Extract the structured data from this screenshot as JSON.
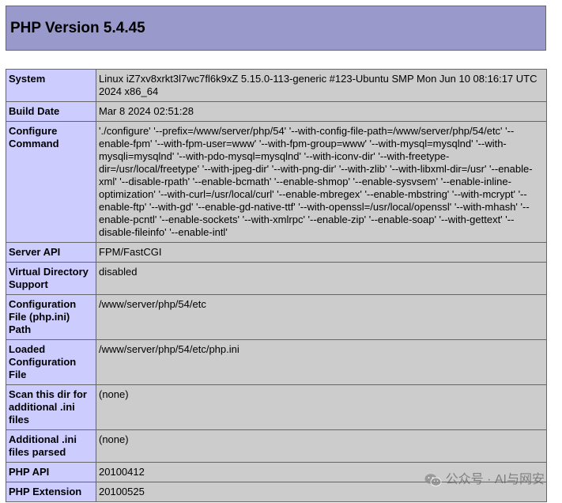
{
  "header": {
    "title": "PHP Version 5.4.45"
  },
  "rows": [
    {
      "key": "System",
      "value": "Linux iZ7xv8xrkt3l7wc7fl6k9xZ 5.15.0-113-generic #123-Ubuntu SMP Mon Jun 10 08:16:17 UTC 2024 x86_64"
    },
    {
      "key": "Build Date",
      "value": "Mar 8 2024 02:51:28"
    },
    {
      "key": "Configure Command",
      "value": "'./configure' '--prefix=/www/server/php/54' '--with-config-file-path=/www/server/php/54/etc' '--enable-fpm' '--with-fpm-user=www' '--with-fpm-group=www' '--with-mysql=mysqlnd' '--with-mysqli=mysqlnd' '--with-pdo-mysql=mysqlnd' '--with-iconv-dir' '--with-freetype-dir=/usr/local/freetype' '--with-jpeg-dir' '--with-png-dir' '--with-zlib' '--with-libxml-dir=/usr' '--enable-xml' '--disable-rpath' '--enable-bcmath' '--enable-shmop' '--enable-sysvsem' '--enable-inline-optimization' '--with-curl=/usr/local/curl' '--enable-mbregex' '--enable-mbstring' '--with-mcrypt' '--enable-ftp' '--with-gd' '--enable-gd-native-ttf' '--with-openssl=/usr/local/openssl' '--with-mhash' '--enable-pcntl' '--enable-sockets' '--with-xmlrpc' '--enable-zip' '--enable-soap' '--with-gettext' '--disable-fileinfo' '--enable-intl'"
    },
    {
      "key": "Server API",
      "value": "FPM/FastCGI"
    },
    {
      "key": "Virtual Directory Support",
      "value": "disabled"
    },
    {
      "key": "Configuration File (php.ini) Path",
      "value": "/www/server/php/54/etc"
    },
    {
      "key": "Loaded Configuration File",
      "value": "/www/server/php/54/etc/php.ini"
    },
    {
      "key": "Scan this dir for additional .ini files",
      "value": "(none)"
    },
    {
      "key": "Additional .ini files parsed",
      "value": "(none)"
    },
    {
      "key": "PHP API",
      "value": "20100412"
    },
    {
      "key": "PHP Extension",
      "value": "20100525"
    }
  ],
  "watermark": {
    "text": "公众号 · AI与网安",
    "icon": "wechat-icon"
  }
}
